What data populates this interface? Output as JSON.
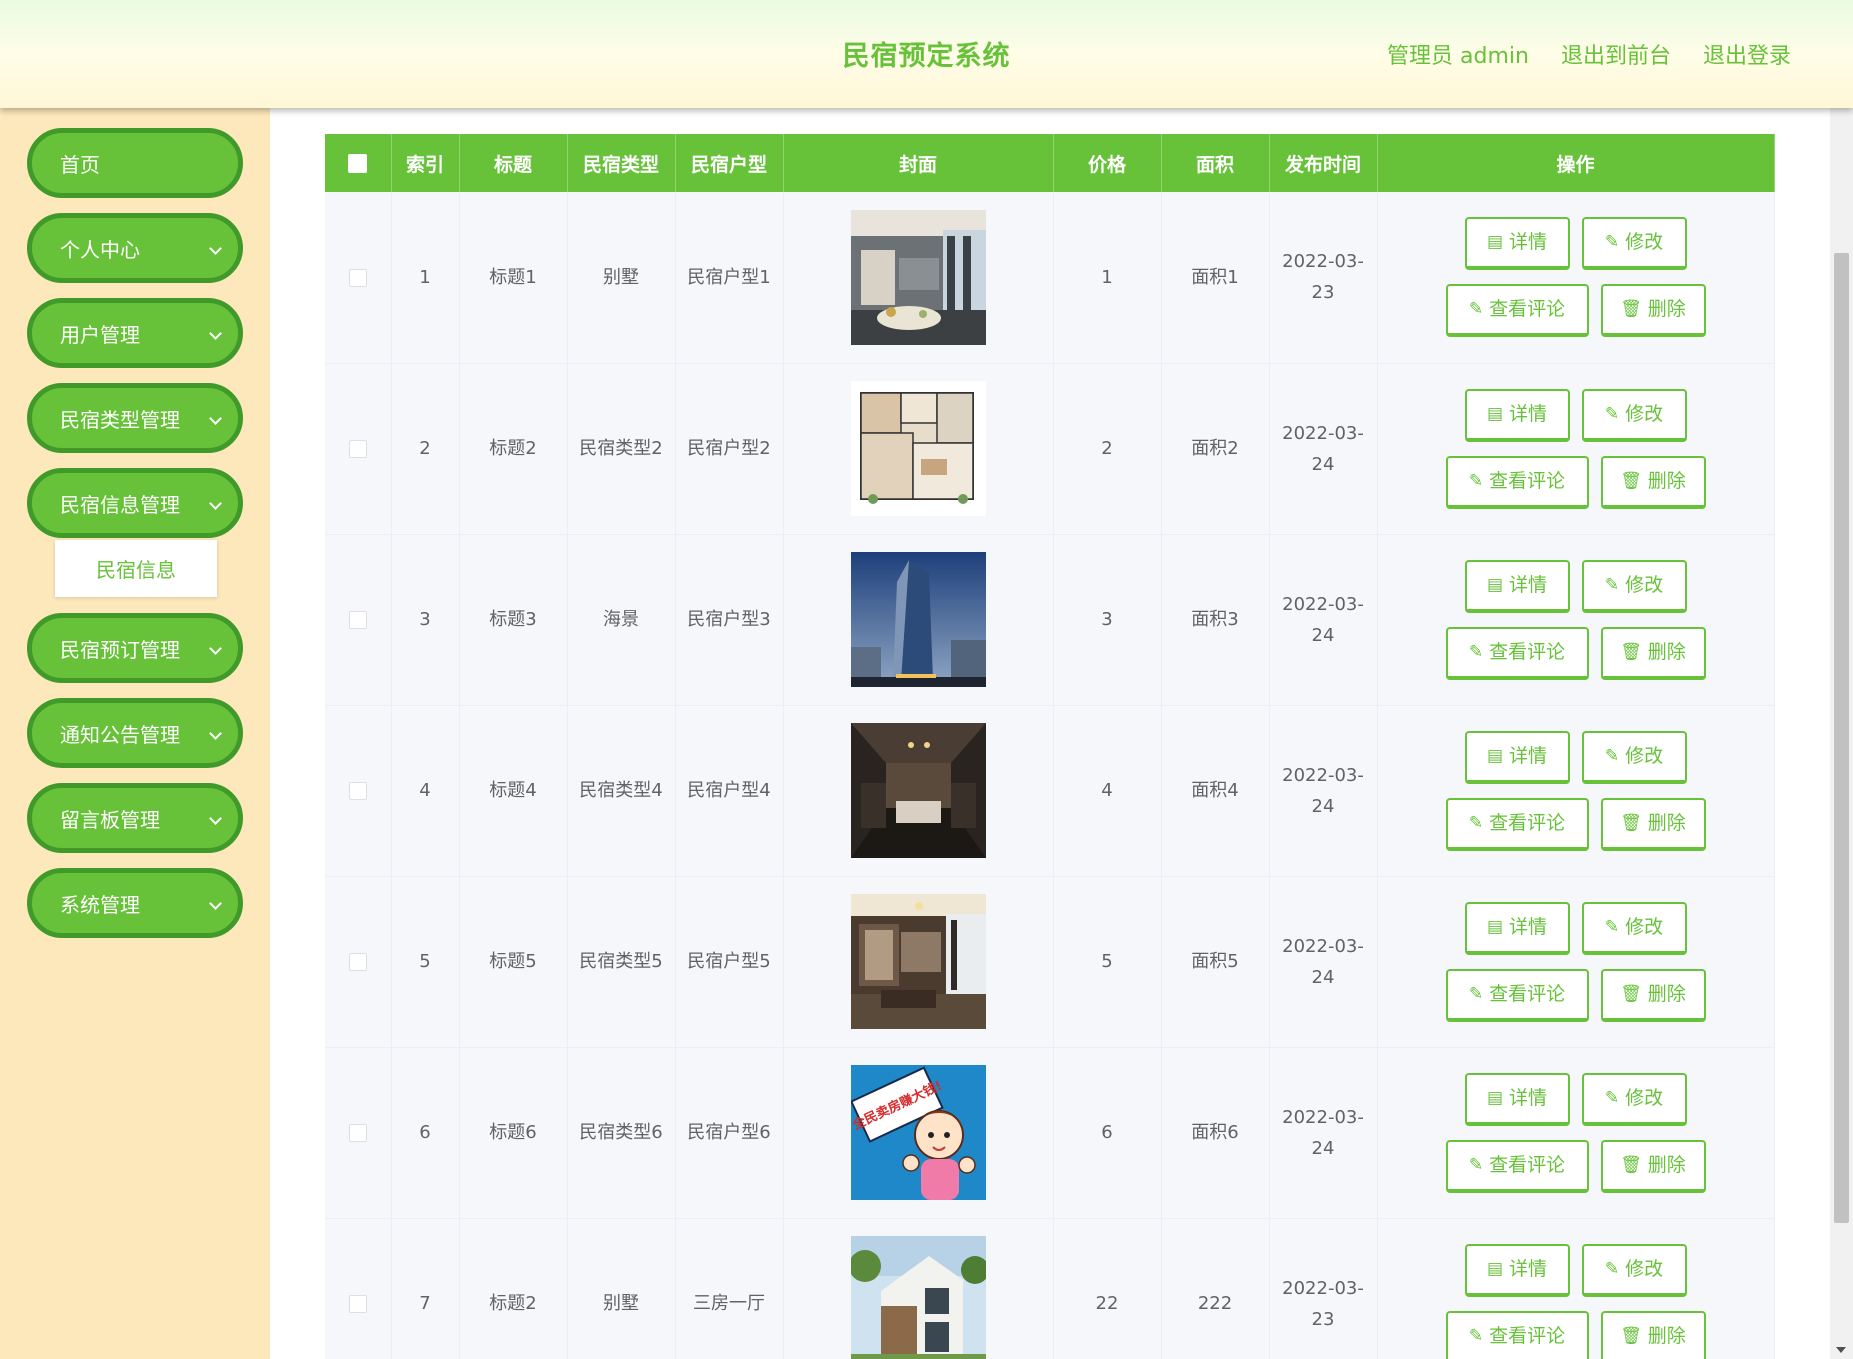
{
  "header": {
    "title": "民宿预定系统",
    "user_label": "管理员 admin",
    "front_link": "退出到前台",
    "logout_link": "退出登录"
  },
  "sidebar": {
    "items": [
      {
        "label": "首页",
        "has_children": false
      },
      {
        "label": "个人中心",
        "has_children": true
      },
      {
        "label": "用户管理",
        "has_children": true
      },
      {
        "label": "民宿类型管理",
        "has_children": true
      },
      {
        "label": "民宿信息管理",
        "has_children": true
      },
      {
        "label": "民宿预订管理",
        "has_children": true
      },
      {
        "label": "通知公告管理",
        "has_children": true
      },
      {
        "label": "留言板管理",
        "has_children": true
      },
      {
        "label": "系统管理",
        "has_children": true
      }
    ],
    "active_sub_item": "民宿信息"
  },
  "table": {
    "headers": {
      "index": "索引",
      "title": "标题",
      "type": "民宿类型",
      "layout": "民宿户型",
      "cover": "封面",
      "price": "价格",
      "area": "面积",
      "date": "发布时间",
      "actions": "操作"
    },
    "rows": [
      {
        "index": "1",
        "title": "标题1",
        "type": "别墅",
        "layout": "民宿户型1",
        "cover": "interior-room",
        "price": "1",
        "area": "面积1",
        "date": "2022-03-23"
      },
      {
        "index": "2",
        "title": "标题2",
        "type": "民宿类型2",
        "layout": "民宿户型2",
        "cover": "floor-plan",
        "price": "2",
        "area": "面积2",
        "date": "2022-03-24"
      },
      {
        "index": "3",
        "title": "标题3",
        "type": "海景",
        "layout": "民宿户型3",
        "cover": "tower-building",
        "price": "3",
        "area": "面积3",
        "date": "2022-03-24"
      },
      {
        "index": "4",
        "title": "标题4",
        "type": "民宿类型4",
        "layout": "民宿户型4",
        "cover": "dark-bedroom",
        "price": "4",
        "area": "面积4",
        "date": "2022-03-24"
      },
      {
        "index": "5",
        "title": "标题5",
        "type": "民宿类型5",
        "layout": "民宿户型5",
        "cover": "luxury-bedroom",
        "price": "5",
        "area": "面积5",
        "date": "2022-03-24"
      },
      {
        "index": "6",
        "title": "标题6",
        "type": "民宿类型6",
        "layout": "民宿户型6",
        "cover": "cartoon-sign",
        "price": "6",
        "area": "面积6",
        "date": "2022-03-24"
      },
      {
        "index": "7",
        "title": "标题2",
        "type": "别墅",
        "layout": "三房一厅",
        "cover": "villa-exterior",
        "price": "22",
        "area": "222",
        "date": "2022-03-23"
      }
    ],
    "actions": {
      "detail": "详情",
      "edit": "修改",
      "comments": "查看评论",
      "delete": "删除"
    },
    "cover_art": {
      "cartoon_sign_text": "全民卖房赚大钱!"
    }
  },
  "colors": {
    "accent": "#67c23a",
    "accent_dark": "#3f9a2a",
    "sidebar_bg": "#fde8bb",
    "row_bg": "#f5f7fa"
  }
}
